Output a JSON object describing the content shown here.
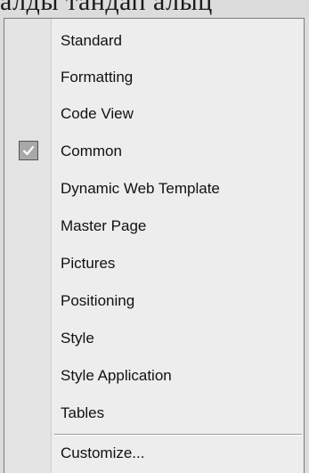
{
  "caption": "алды тандап алыц",
  "menu": {
    "items": [
      {
        "label": "Standard",
        "checked": false
      },
      {
        "label": "Formatting",
        "checked": false
      },
      {
        "label": "Code View",
        "checked": false
      },
      {
        "label": "Common",
        "checked": true
      },
      {
        "label": "Dynamic Web Template",
        "checked": false
      },
      {
        "label": "Master Page",
        "checked": false
      },
      {
        "label": "Pictures",
        "checked": false
      },
      {
        "label": "Positioning",
        "checked": false
      },
      {
        "label": "Style",
        "checked": false
      },
      {
        "label": "Style Application",
        "checked": false
      },
      {
        "label": "Tables",
        "checked": false
      }
    ],
    "customize_label": "Customize...",
    "check_icon": "checkmark-icon"
  }
}
